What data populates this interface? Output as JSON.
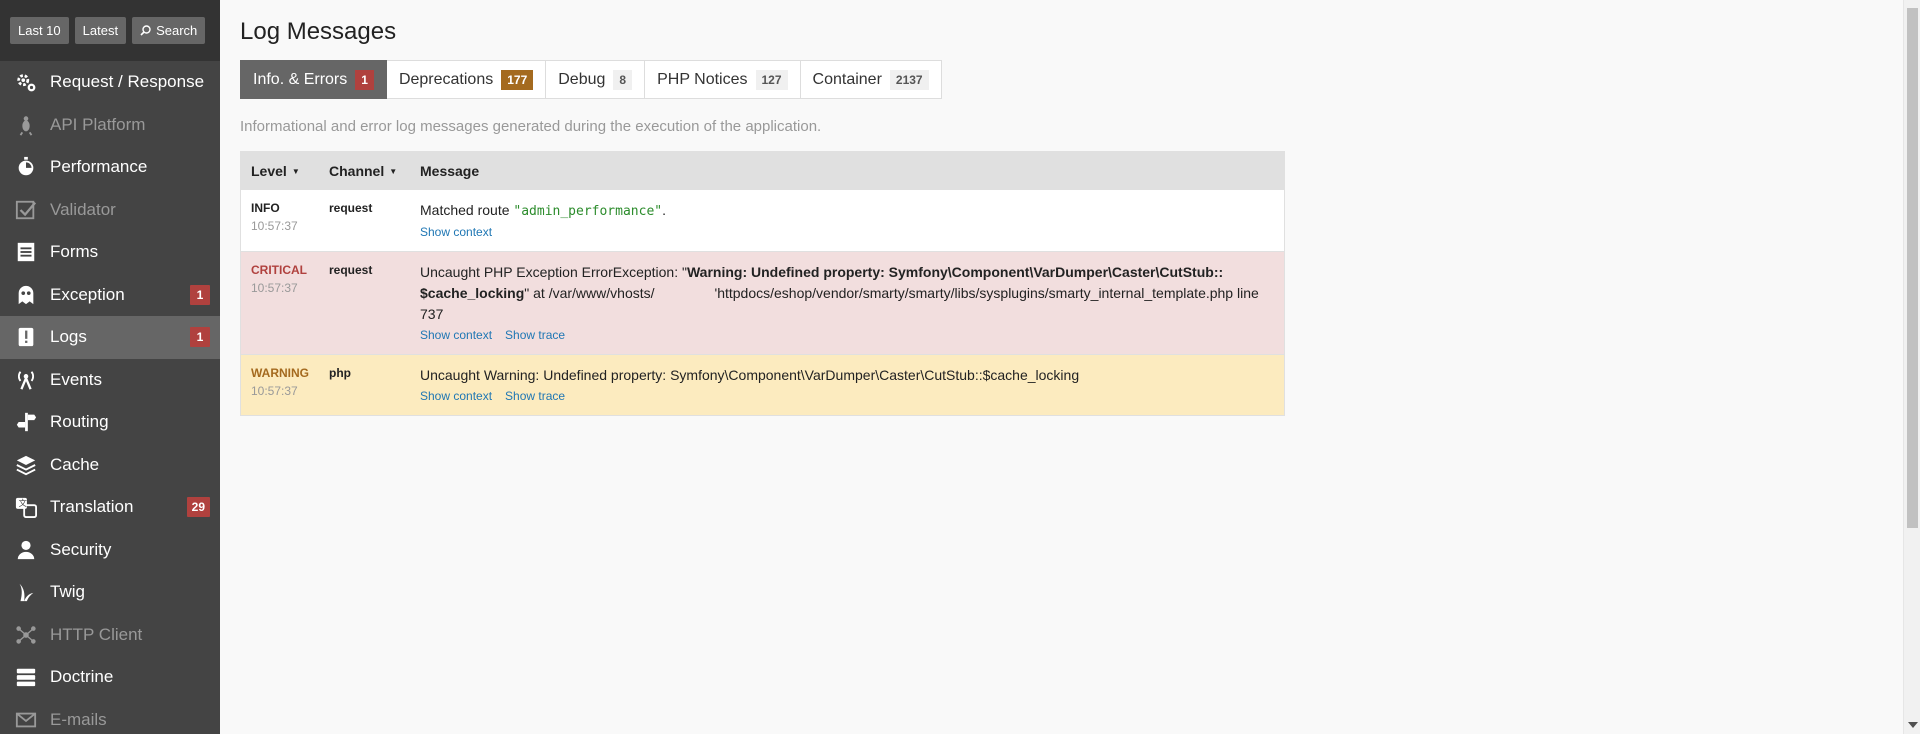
{
  "shortcuts": {
    "last10": "Last 10",
    "latest": "Latest",
    "search": "Search"
  },
  "sidebar": {
    "items": [
      {
        "label": "Request / Response",
        "icon": "gears-icon",
        "state": "normal",
        "count": ""
      },
      {
        "label": "API Platform",
        "icon": "spider-icon",
        "state": "disabled",
        "count": ""
      },
      {
        "label": "Performance",
        "icon": "stopwatch-icon",
        "state": "normal",
        "count": ""
      },
      {
        "label": "Validator",
        "icon": "checkbox-icon",
        "state": "disabled",
        "count": ""
      },
      {
        "label": "Forms",
        "icon": "form-icon",
        "state": "normal",
        "count": ""
      },
      {
        "label": "Exception",
        "icon": "ghost-icon",
        "state": "normal",
        "count": "1"
      },
      {
        "label": "Logs",
        "icon": "log-icon",
        "state": "selected",
        "count": "1"
      },
      {
        "label": "Events",
        "icon": "broadcast-icon",
        "state": "normal",
        "count": ""
      },
      {
        "label": "Routing",
        "icon": "signpost-icon",
        "state": "normal",
        "count": ""
      },
      {
        "label": "Cache",
        "icon": "layers-icon",
        "state": "normal",
        "count": ""
      },
      {
        "label": "Translation",
        "icon": "translate-icon",
        "state": "normal",
        "count": "29"
      },
      {
        "label": "Security",
        "icon": "user-icon",
        "state": "normal",
        "count": ""
      },
      {
        "label": "Twig",
        "icon": "twig-icon",
        "state": "normal",
        "count": ""
      },
      {
        "label": "HTTP Client",
        "icon": "network-icon",
        "state": "disabled",
        "count": ""
      },
      {
        "label": "Doctrine",
        "icon": "database-icon",
        "state": "normal",
        "count": ""
      },
      {
        "label": "E-mails",
        "icon": "envelope-icon",
        "state": "disabled",
        "count": ""
      }
    ]
  },
  "main": {
    "title": "Log Messages",
    "tabs": [
      {
        "label": "Info. & Errors",
        "count": "1"
      },
      {
        "label": "Deprecations",
        "count": "177"
      },
      {
        "label": "Debug",
        "count": "8"
      },
      {
        "label": "PHP Notices",
        "count": "127"
      },
      {
        "label": "Container",
        "count": "2137"
      }
    ],
    "help": "Informational and error log messages generated during the execution of the application.",
    "table": {
      "headers": {
        "level": "Level",
        "channel": "Channel",
        "message": "Message"
      },
      "rows": [
        {
          "level": "INFO",
          "time": "10:57:37",
          "channel": "request",
          "message_prefix": "Matched route ",
          "message_code": "\"admin_performance\"",
          "message_suffix": ".",
          "show_context": "Show context"
        },
        {
          "level": "CRITICAL",
          "time": "10:57:37",
          "channel": "request",
          "message_prefix": "Uncaught PHP Exception ErrorException: \"",
          "message_bold": "Warning: Undefined property: Symfony\\Component\\VarDumper\\Caster\\CutStub:: $cache_locking",
          "message_mid": "\" at /var/www/vhosts/",
          "message_path": "'httpdocs/eshop/vendor/smarty/smarty/libs/sysplugins/smarty_internal_template.php line 737",
          "show_context": "Show context",
          "show_trace": "Show trace"
        },
        {
          "level": "WARNING",
          "time": "10:57:37",
          "channel": "php",
          "message": "Uncaught Warning: Undefined property: Symfony\\Component\\VarDumper\\Caster\\CutStub::$cache_locking",
          "show_context": "Show context",
          "show_trace": "Show trace"
        }
      ]
    }
  },
  "colors": {
    "sidebar_bg": "#444444",
    "critical": "#b0413e",
    "warning": "#a46a1f",
    "link": "#2077b4"
  }
}
